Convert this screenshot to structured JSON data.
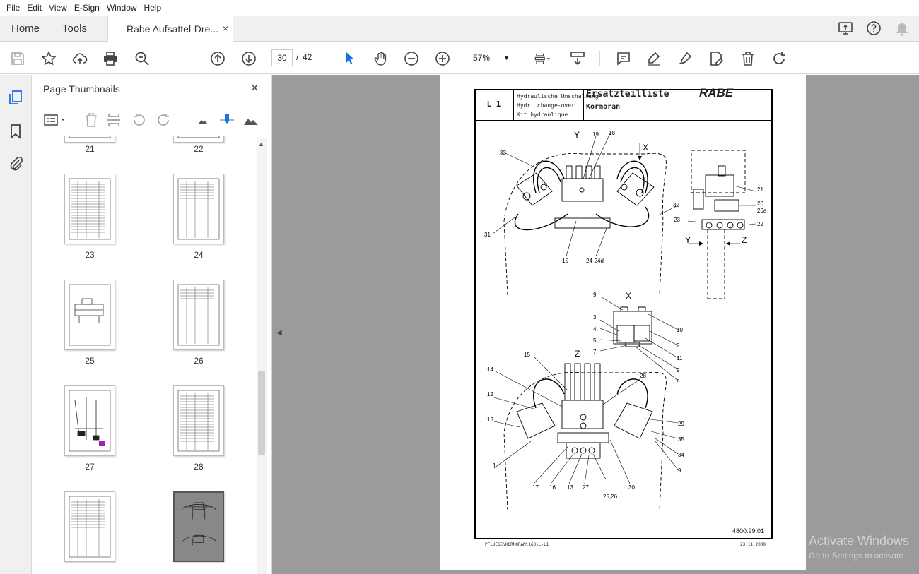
{
  "menu": {
    "items": [
      "File",
      "Edit",
      "View",
      "E-Sign",
      "Window",
      "Help"
    ]
  },
  "tabs": {
    "home": "Home",
    "tools": "Tools",
    "document": "Rabe Aufsattel-Dre...",
    "close": "×"
  },
  "toolbar": {
    "page_current": "30",
    "page_separator": "/",
    "page_total": "42",
    "zoom": "57%"
  },
  "thumbnails": {
    "title": "Page Thumbnails",
    "close": "×",
    "items": [
      {
        "label": "21"
      },
      {
        "label": "22"
      },
      {
        "label": "23"
      },
      {
        "label": "24"
      },
      {
        "label": "25"
      },
      {
        "label": "26"
      },
      {
        "label": "27"
      },
      {
        "label": "28"
      },
      {
        "label": ""
      },
      {
        "label": ""
      }
    ]
  },
  "document_page": {
    "code": "L 1",
    "desc_de": "Hydraulische Umschaltung",
    "desc_en": "Hydr. change-over",
    "desc_fr": "Kit hydraulique",
    "title": "Ersatzteilliste",
    "model": "Kormoran",
    "brand": "RABE",
    "doc_number": "4800.99.01",
    "footer_path": "PFLUEGE\\KORMORAN\\160\\L-L1",
    "footer_date": "23.11.2000",
    "callouts": {
      "y_view": "Y",
      "x_arrow": "X",
      "n19": "19",
      "n18": "18",
      "n33": "33",
      "n32": "32",
      "n31": "31",
      "n15a": "15",
      "n24": "24-24d",
      "n21": "21",
      "n20": "20",
      "n20a": "20a",
      "n22": "22",
      "n23": "23",
      "y_arrow": "Y",
      "z_arrow": "Z",
      "x_view": "X",
      "n9a": "9",
      "n10": "10",
      "n3": "3",
      "n4": "4",
      "n5": "5",
      "n7": "7",
      "n2": "2",
      "n11": "11",
      "n9b": "9",
      "n8": "8",
      "z_view": "Z",
      "n15b": "15",
      "n14": "14",
      "n28": "28",
      "n12": "12",
      "n13a": "13",
      "n29": "29",
      "n35": "35",
      "n34": "34",
      "n1": "1",
      "n9c": "9",
      "n17": "17",
      "n16": "16",
      "n13b": "13",
      "n27": "27",
      "n2526": "25,26",
      "n30": "30"
    }
  },
  "watermark": {
    "line1": "Activate Windows",
    "line2": "Go to Settings to activate"
  }
}
